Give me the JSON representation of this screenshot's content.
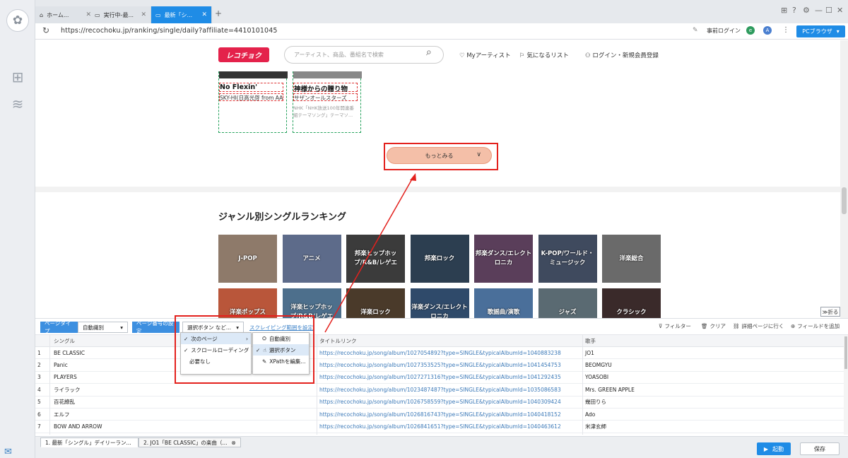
{
  "tabs": [
    {
      "label": "ホーム...",
      "icon": "home-icon"
    },
    {
      "label": "実行中-最...",
      "icon": "window-icon"
    },
    {
      "label": "最新「シ...",
      "icon": "window-icon"
    }
  ],
  "address": {
    "url": "https://recochoku.jp/ranking/single/daily?affiliate=4410101045",
    "pre_login": "事前ログイン",
    "pc_browser": "PCブラウザ"
  },
  "site": {
    "brand": "レコチョク",
    "search_placeholder": "アーティスト、商品、番組名で検索",
    "nav": {
      "my_artist": "Myアーティスト",
      "wishlist": "気になるリスト",
      "login": "ログイン・新規会員登録"
    },
    "cards": [
      {
        "title": "No Flexin'",
        "artist": "SKY-HI(日高光啓 from AA...",
        "desc": ""
      },
      {
        "title": "神様からの贈り物",
        "artist": "サザンオールスターズ",
        "desc": "NHK「NHK放送100年開連番組テーマソング」テーマソ..."
      }
    ],
    "more_button": "もっとみる",
    "genre_title": "ジャンル別シングルランキング",
    "genres_row1": [
      "J-POP",
      "アニメ",
      "邦楽ヒップホップ/R&B/レゲエ",
      "邦楽ロック",
      "邦楽ダンス/エレクトロニカ",
      "K-POP/ワールド・ミュージック",
      "洋楽総合"
    ],
    "genres_row2": [
      "洋楽ポップス",
      "洋楽ヒップホップ/R&B/レゲエ",
      "洋楽ロック",
      "洋楽ダンス/エレクトロニカ",
      "歌謡曲/演歌",
      "ジャズ",
      "クラシック"
    ],
    "fold": "折る"
  },
  "toolbar": {
    "page_type_label": "ページタイプ",
    "page_type_value": "自動識別",
    "page_num_label": "ページ番号の設定",
    "page_num_value": "選択ボタン など...",
    "scrape_link": "スクレイピング範囲を設定",
    "filter": "フィルター",
    "clear": "クリア",
    "detail": "詳細ページに行く",
    "add_field": "フィールドを追加"
  },
  "menu1": [
    "次のページ",
    "スクロールローディング",
    "必要なし"
  ],
  "menu2": [
    "自動識別",
    "選択ボタン",
    "XPathを編集..."
  ],
  "table": {
    "headers": [
      "シングル",
      "タイトルリンク",
      "歌手"
    ],
    "rows": [
      {
        "n": "1",
        "single": "BE CLASSIC",
        "link": "https://recochoku.jp/song/album/1027054892?type=SINGLE&typicalAlbumId=1040883238",
        "artist": "JO1"
      },
      {
        "n": "2",
        "single": "Panic",
        "link": "https://recochoku.jp/song/album/1027353525?type=SINGLE&typicalAlbumId=1041454753",
        "artist": "BEOMGYU"
      },
      {
        "n": "3",
        "single": "PLAYERS",
        "link": "https://recochoku.jp/song/album/1027271316?type=SINGLE&typicalAlbumId=1041292435",
        "artist": "YOASOBI"
      },
      {
        "n": "4",
        "single": "ライラック",
        "link": "https://recochoku.jp/song/album/1023487487?type=SINGLE&typicalAlbumId=1035086583",
        "artist": "Mrs. GREEN APPLE"
      },
      {
        "n": "5",
        "single": "百花繚乱",
        "link": "https://recochoku.jp/song/album/1026758559?type=SINGLE&typicalAlbumId=1040309424",
        "artist": "幾田りら"
      },
      {
        "n": "6",
        "single": "エルフ",
        "link": "https://recochoku.jp/song/album/1026816743?type=SINGLE&typicalAlbumId=1040418152",
        "artist": "Ado"
      },
      {
        "n": "7",
        "single": "BOW AND ARROW",
        "link": "https://recochoku.jp/song/album/1026841651?type=SINGLE&typicalAlbumId=1040463612",
        "artist": "米津玄師"
      }
    ]
  },
  "bottom_tabs": [
    "1. 最新「シングル」デイリーラン...",
    "2. JO1「BE CLASSIC」の楽曲（..."
  ],
  "run": "起動",
  "save": "保存"
}
